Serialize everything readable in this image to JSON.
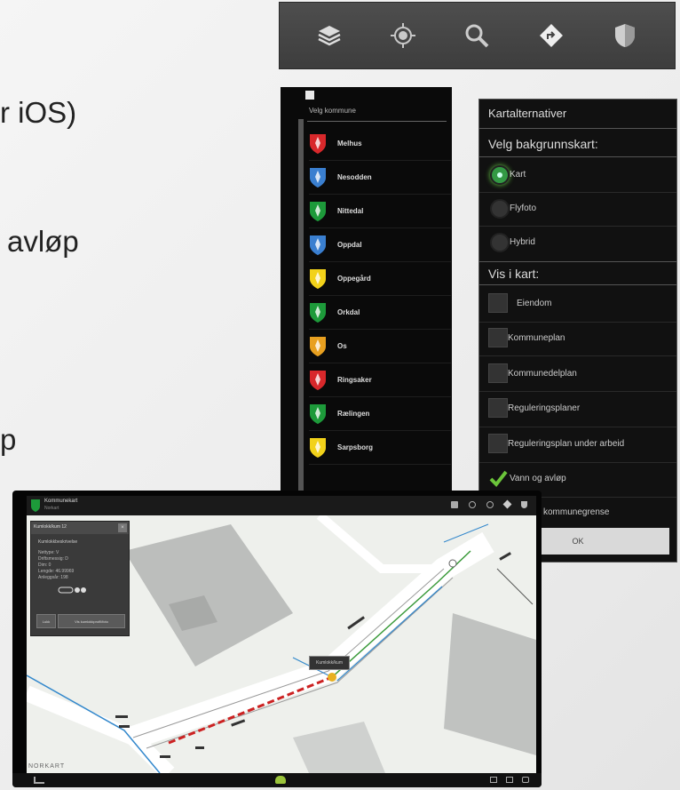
{
  "slide": {
    "lines": [
      "r iOS)",
      "avløp",
      "p"
    ]
  },
  "toolbar": {
    "icons": [
      "layers-icon",
      "location-target-icon",
      "search-icon",
      "directions-icon",
      "shield-icon"
    ]
  },
  "kommune_list": {
    "title": "Velg kommune",
    "items": [
      "Melhus",
      "Nesodden",
      "Nittedal",
      "Oppdal",
      "Oppegård",
      "Orkdal",
      "Os",
      "Ringsaker",
      "Rælingen",
      "Sarpsborg"
    ],
    "crest_colors": [
      "#d8282b",
      "#3a7fd0",
      "#1d9a3a",
      "#3a7fd0",
      "#f2d21a",
      "#1d9a3a",
      "#e8a020",
      "#d8282b",
      "#1d9a3a",
      "#f2d21a"
    ]
  },
  "kartalternativer": {
    "title": "Kartalternativer",
    "background_heading": "Velg bakgrunnskart:",
    "background_options": [
      {
        "label": "Kart",
        "selected": true
      },
      {
        "label": "Flyfoto",
        "selected": false
      },
      {
        "label": "Hybrid",
        "selected": false
      }
    ],
    "show_heading": "Vis i kart:",
    "layers": [
      {
        "label": "Eiendom",
        "checked": false
      },
      {
        "label": "Kommuneplan",
        "checked": false
      },
      {
        "label": "Kommunedelplan",
        "checked": false
      },
      {
        "label": "Reguleringsplaner",
        "checked": false
      },
      {
        "label": "Reguleringsplan under arbeid",
        "checked": false
      },
      {
        "label": "Vann og avløp",
        "checked": true
      },
      {
        "label": "kommunegrense",
        "checked": false
      }
    ],
    "ok_label": "OK",
    "accent": "#6bc43a"
  },
  "tablet": {
    "app_title": "Kommunekart",
    "app_subtitle": "Norkart",
    "popup": {
      "header": "Kumlokk/kum 12",
      "heading": "Kumlokkbeskrivelse",
      "lines": [
        "Nettype: V",
        "Driftsmessig: D",
        "Dim: 0",
        "Lengde: 46.99969",
        "Anleggsår: 198"
      ],
      "buttons": [
        "Lukk",
        "Vis kumlokkprofil/foto"
      ]
    },
    "callout": "Kumlokk/kum",
    "watermark": "NORKART"
  }
}
